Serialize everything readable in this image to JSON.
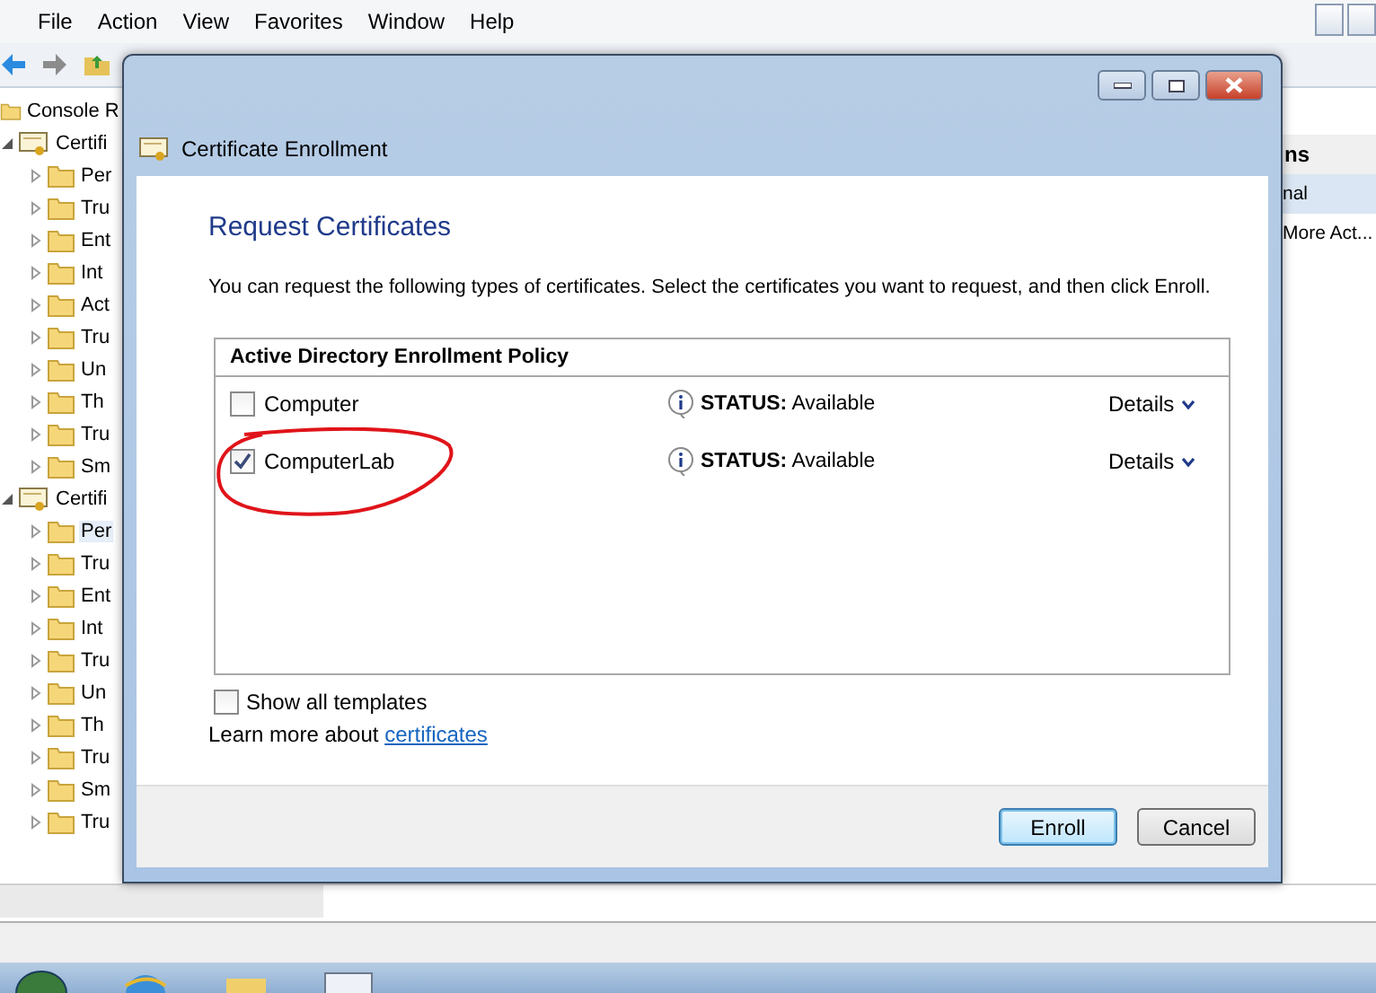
{
  "window": {
    "menu": [
      "File",
      "Action",
      "View",
      "Favorites",
      "Window",
      "Help"
    ]
  },
  "tree": {
    "items": [
      {
        "label": "Console R",
        "kind": "root"
      },
      {
        "label": "Certifi",
        "kind": "store",
        "expanded": true,
        "selected": false,
        "children": [
          {
            "label": "Per",
            "selected": false
          },
          {
            "label": "Tru",
            "selected": false
          },
          {
            "label": "Ent",
            "selected": false
          },
          {
            "label": "Int",
            "selected": false
          },
          {
            "label": "Act",
            "selected": false
          },
          {
            "label": "Tru",
            "selected": false
          },
          {
            "label": "Un",
            "selected": false
          },
          {
            "label": "Th",
            "selected": false
          },
          {
            "label": "Tru",
            "selected": false
          },
          {
            "label": "Sm",
            "selected": false
          }
        ]
      },
      {
        "label": "Certifi",
        "kind": "store",
        "expanded": true,
        "selected": false,
        "children": [
          {
            "label": "Per",
            "selected": true
          },
          {
            "label": "Tru",
            "selected": false
          },
          {
            "label": "Ent",
            "selected": false
          },
          {
            "label": "Int",
            "selected": false
          },
          {
            "label": "Tru",
            "selected": false
          },
          {
            "label": "Un",
            "selected": false
          },
          {
            "label": "Th",
            "selected": false
          },
          {
            "label": "Tru",
            "selected": false
          },
          {
            "label": "Sm",
            "selected": false
          },
          {
            "label": "Tru",
            "selected": false
          }
        ]
      }
    ]
  },
  "actions_pane": {
    "header": "ns",
    "items": [
      {
        "label": "nal",
        "selected": true
      },
      {
        "label": "More Act...",
        "selected": false
      }
    ]
  },
  "dialog": {
    "title": "Certificate Enrollment",
    "heading": "Request Certificates",
    "description": "You can request the following types of certificates. Select the certificates you want to request, and then click Enroll.",
    "policy": {
      "title": "Active Directory Enrollment Policy",
      "rows": [
        {
          "name": "Computer",
          "checked": false,
          "status_label": "STATUS:",
          "status": "Available",
          "details": "Details",
          "annotated": false
        },
        {
          "name": "ComputerLab",
          "checked": true,
          "status_label": "STATUS:",
          "status": "Available",
          "details": "Details",
          "annotated": true
        }
      ]
    },
    "show_all": {
      "label": "Show all templates",
      "checked": false
    },
    "learn_more": {
      "text": "Learn more about",
      "link": "certificates"
    },
    "buttons": [
      {
        "label": "Enroll",
        "default": true
      },
      {
        "label": "Cancel",
        "default": false
      }
    ]
  }
}
